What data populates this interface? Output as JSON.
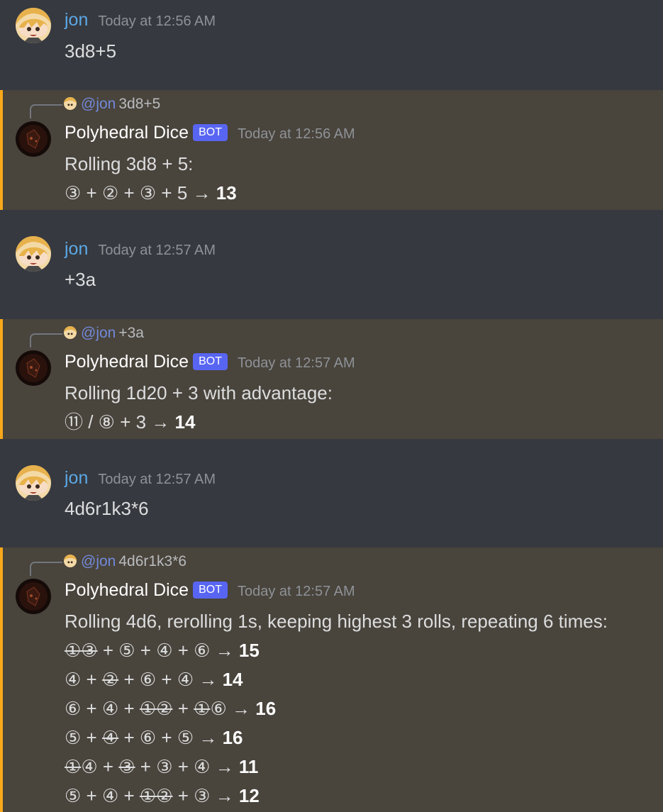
{
  "messages": [
    {
      "author": "jon",
      "timestamp": "Today at 12:56 AM",
      "text": "3d8+5"
    },
    {
      "reply": {
        "mention": "@jon",
        "text": "3d8+5"
      },
      "author": "Polyhedral Dice",
      "badge": "BOT",
      "timestamp": "Today at 12:56 AM",
      "header": "Rolling 3d8 + 5:",
      "lines": [
        {
          "parts": [
            {
              "t": "③ + ② + ③ + 5 → "
            }
          ],
          "total": "13"
        }
      ]
    },
    {
      "author": "jon",
      "timestamp": "Today at 12:57 AM",
      "text": "+3a"
    },
    {
      "reply": {
        "mention": "@jon",
        "text": "+3a"
      },
      "author": "Polyhedral Dice",
      "badge": "BOT",
      "timestamp": "Today at 12:57 AM",
      "header": "Rolling 1d20 + 3 with advantage:",
      "lines": [
        {
          "parts": [
            {
              "t": "⑪ / ⑧ + 3 → "
            }
          ],
          "total": "14"
        }
      ]
    },
    {
      "author": "jon",
      "timestamp": "Today at 12:57 AM",
      "text": "4d6r1k3*6"
    },
    {
      "reply": {
        "mention": "@jon",
        "text": "4d6r1k3*6"
      },
      "author": "Polyhedral Dice",
      "badge": "BOT",
      "timestamp": "Today at 12:57 AM",
      "header": "Rolling 4d6, rerolling 1s, keeping highest 3 rolls, repeating 6 times:",
      "lines": [
        {
          "parts": [
            {
              "t": "①",
              "s": true
            },
            {
              "t": "③",
              "s": true
            },
            {
              "t": " + ⑤ + ④ + ⑥ → "
            }
          ],
          "total": "15"
        },
        {
          "parts": [
            {
              "t": "④ + "
            },
            {
              "t": "②",
              "s": true
            },
            {
              "t": " + ⑥ + ④ → "
            }
          ],
          "total": "14"
        },
        {
          "parts": [
            {
              "t": "⑥ + ④ + "
            },
            {
              "t": "①",
              "s": true
            },
            {
              "t": "②",
              "s": true
            },
            {
              "t": " + "
            },
            {
              "t": "①",
              "s": true
            },
            {
              "t": "⑥ → "
            }
          ],
          "total": "16"
        },
        {
          "parts": [
            {
              "t": "⑤ + "
            },
            {
              "t": "④",
              "s": true
            },
            {
              "t": " + ⑥ + ⑤ → "
            }
          ],
          "total": "16"
        },
        {
          "parts": [
            {
              "t": "①",
              "s": true
            },
            {
              "t": "④ + "
            },
            {
              "t": "③",
              "s": true
            },
            {
              "t": " + ③ + ④ → "
            }
          ],
          "total": "11"
        },
        {
          "parts": [
            {
              "t": "⑤ + ④ + "
            },
            {
              "t": "①",
              "s": true
            },
            {
              "t": "②",
              "s": true
            },
            {
              "t": " + ③ → "
            }
          ],
          "total": "12"
        }
      ]
    }
  ]
}
